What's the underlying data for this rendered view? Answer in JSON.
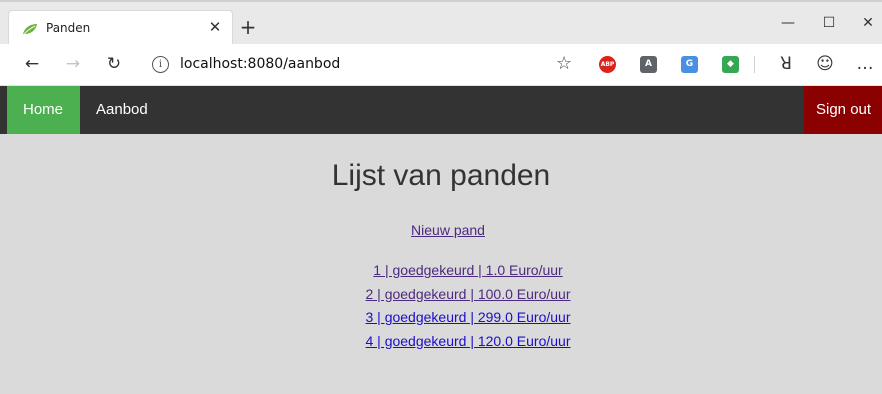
{
  "browser": {
    "tab": {
      "title": "Panden",
      "favicon": "spring-leaf-icon"
    },
    "address_bar": {
      "url": "localhost:8080/aanbod"
    },
    "extensions": [
      {
        "name": "abp-icon",
        "label": "ABP",
        "color": "#d9231c"
      },
      {
        "name": "a-extension-icon",
        "label": "A",
        "color": "#5f6368"
      },
      {
        "name": "google-translate-icon",
        "label": "G",
        "color": "#4a90e2"
      },
      {
        "name": "color-extension-icon",
        "label": "◆",
        "color": "#34a853"
      }
    ]
  },
  "navbar": {
    "home_label": "Home",
    "aanbod_label": "Aanbod",
    "signout_label": "Sign out",
    "colors": {
      "bar": "#333333",
      "home": "#4caf50",
      "signout": "#8b0000"
    }
  },
  "main": {
    "title": "Lijst van panden",
    "new_link": "Nieuw pand",
    "listings": [
      {
        "label": "1 | goedgekeurd | 1.0 Euro/uur",
        "visited": true
      },
      {
        "label": "2 | goedgekeurd | 100.0 Euro/uur",
        "visited": true
      },
      {
        "label": "3 | goedgekeurd | 299.0 Euro/uur",
        "visited": false
      },
      {
        "label": "4 | goedgekeurd | 120.0 Euro/uur",
        "visited": false
      }
    ]
  }
}
